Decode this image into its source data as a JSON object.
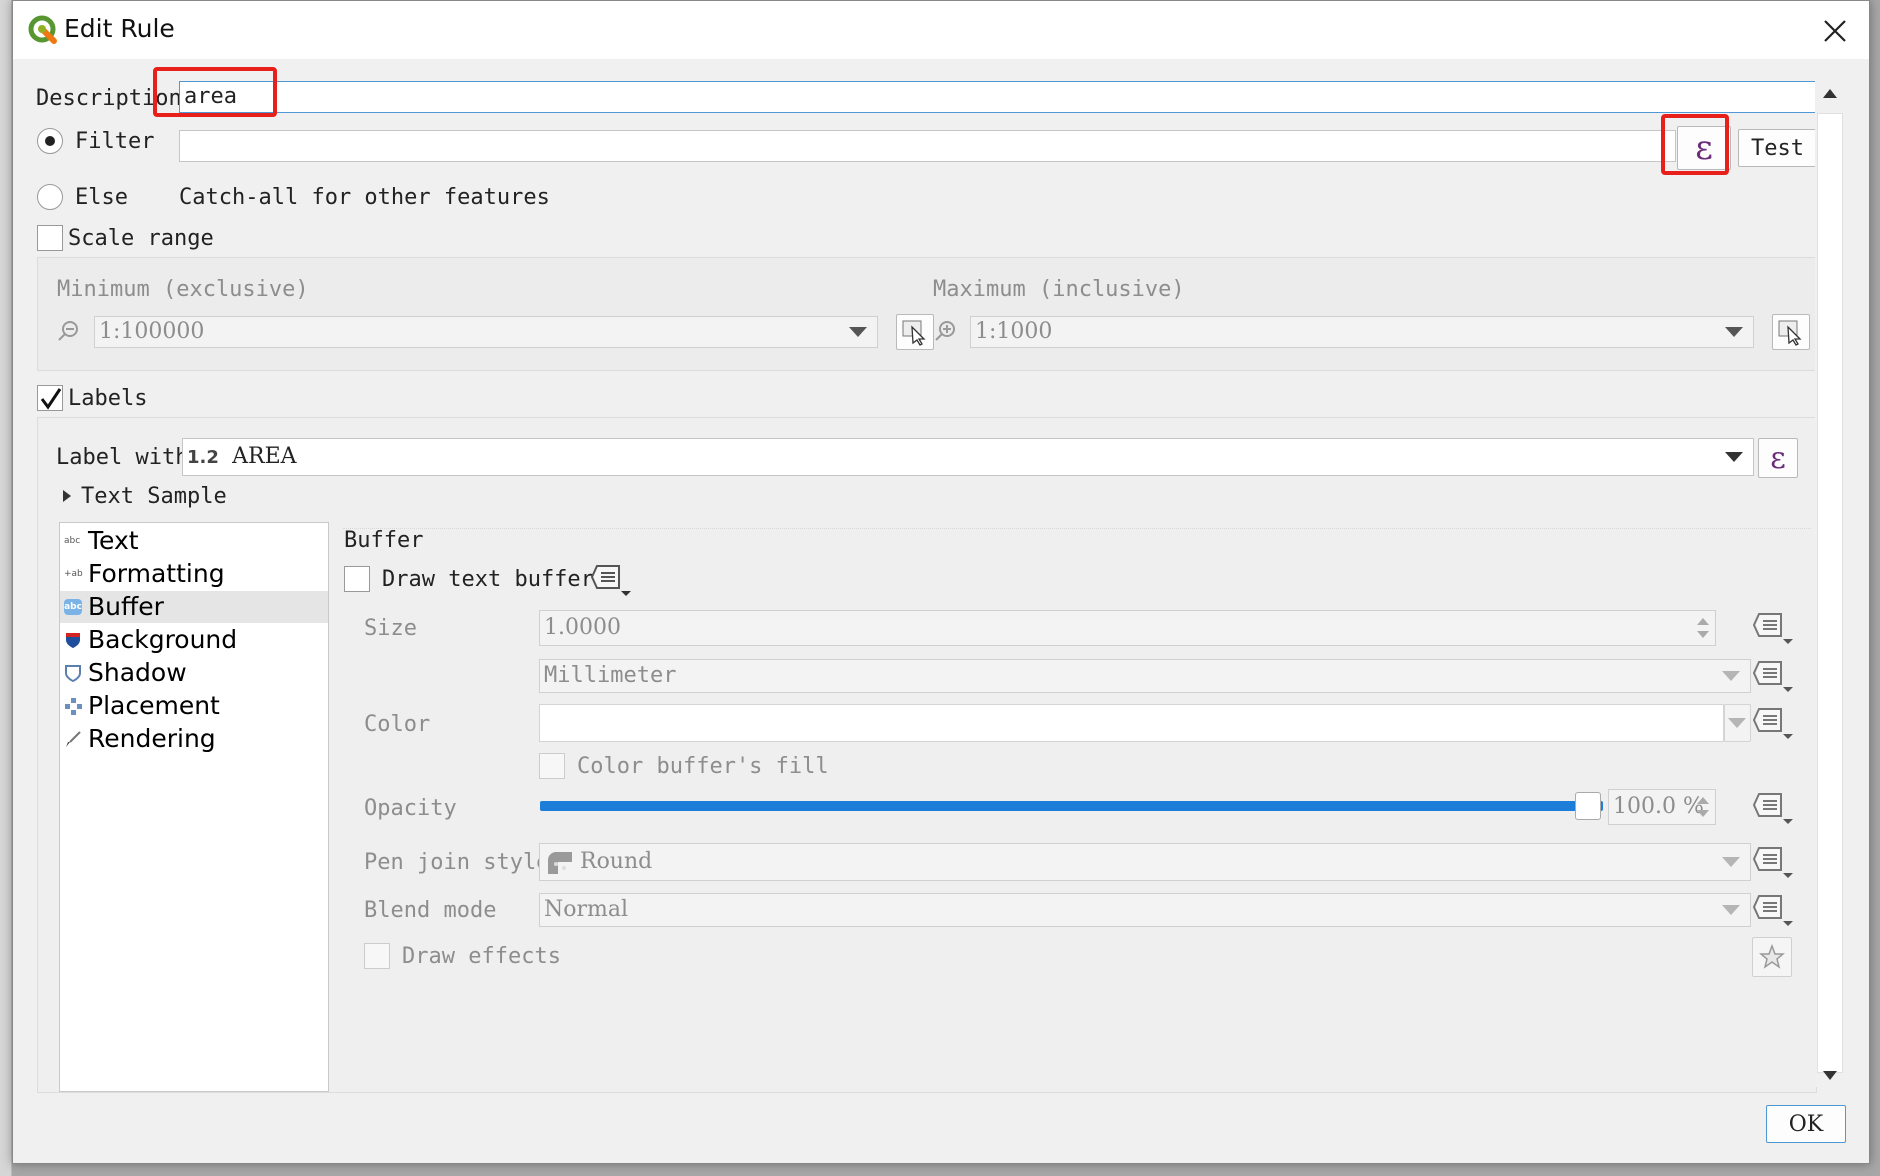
{
  "window": {
    "title": "Edit Rule",
    "close_label": "×"
  },
  "description": {
    "label": "Description",
    "value": "area"
  },
  "filter": {
    "label": "Filter",
    "value": "",
    "expression_icon": "ε",
    "test_label": "Test"
  },
  "else": {
    "label": "Else",
    "hint": "Catch-all for other features"
  },
  "scale_range": {
    "label": "Scale range",
    "minimum_label": "Minimum (exclusive)",
    "minimum_value": "1:100000",
    "maximum_label": "Maximum (inclusive)",
    "maximum_value": "1:1000"
  },
  "labels": {
    "label": "Labels",
    "label_with": "Label with",
    "field_prefix": "1.2",
    "field_name": "AREA",
    "expression_icon": "ε",
    "text_sample": "Text Sample"
  },
  "sidebar": {
    "items": [
      {
        "label": "Text",
        "icon": "abc"
      },
      {
        "label": "Formatting",
        "icon": "+ab"
      },
      {
        "label": "Buffer",
        "icon": "abc"
      },
      {
        "label": "Background",
        "icon": "shield"
      },
      {
        "label": "Shadow",
        "icon": "shadow"
      },
      {
        "label": "Placement",
        "icon": "placement"
      },
      {
        "label": "Rendering",
        "icon": "brush"
      }
    ],
    "selected": "Buffer"
  },
  "buffer": {
    "section_title": "Buffer",
    "draw_label": "Draw text buffer",
    "size_label": "Size",
    "size_value": "1.0000",
    "unit_value": "Millimeter",
    "color_label": "Color",
    "color_fill_label": "Color buffer's fill",
    "opacity_label": "Opacity",
    "opacity_value": "100.0 %",
    "opacity_fraction": 1.0,
    "pen_join_label": "Pen join style",
    "pen_join_value": "Round",
    "blend_label": "Blend mode",
    "blend_value": "Normal",
    "effects_label": "Draw effects"
  },
  "footer": {
    "ok_label": "OK"
  },
  "colors": {
    "accent": "#1c7ed9",
    "highlight": "#e8201c",
    "expression": "#6b2d7a"
  }
}
